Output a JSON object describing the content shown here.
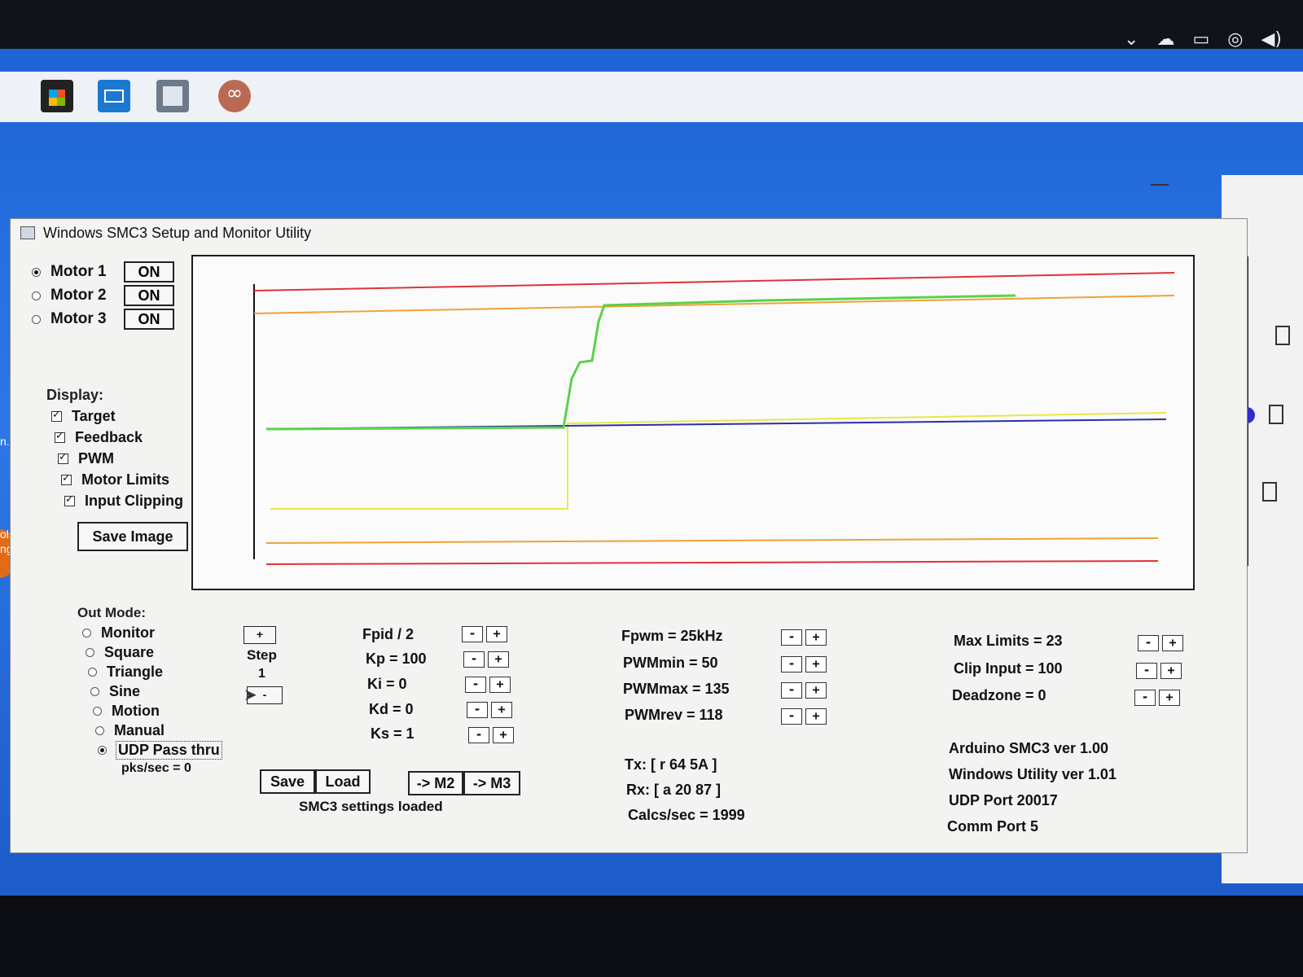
{
  "window": {
    "title": "Windows SMC3 Setup and Monitor Utility"
  },
  "desktop": {
    "side_label_1": "ols",
    "side_label_2": "ngine",
    "side_label_3": "n..."
  },
  "motors": [
    {
      "label": "Motor 1",
      "button": "ON",
      "selected": true
    },
    {
      "label": "Motor 2",
      "button": "ON",
      "selected": false
    },
    {
      "label": "Motor 3",
      "button": "ON",
      "selected": false
    }
  ],
  "display": {
    "heading": "Display:",
    "options": [
      {
        "label": "Target",
        "checked": true
      },
      {
        "label": "Feedback",
        "checked": true
      },
      {
        "label": "PWM",
        "checked": true
      },
      {
        "label": "Motor Limits",
        "checked": true
      },
      {
        "label": "Input Clipping",
        "checked": true
      }
    ],
    "save_image": "Save Image"
  },
  "out_mode": {
    "heading": "Out Mode:",
    "options": [
      {
        "label": "Monitor",
        "selected": false
      },
      {
        "label": "Square",
        "selected": false
      },
      {
        "label": "Triangle",
        "selected": false
      },
      {
        "label": "Sine",
        "selected": false
      },
      {
        "label": "Motion",
        "selected": false
      },
      {
        "label": "Manual",
        "selected": false
      },
      {
        "label": "UDP Pass thru",
        "selected": true
      }
    ],
    "pks_sec": "pks/sec = 0"
  },
  "step": {
    "plus": "+",
    "label": "Step",
    "value": "1",
    "minus": "-"
  },
  "pid_params": {
    "fpid": "Fpid / 2",
    "kp": "Kp = 100",
    "ki": "Ki = 0",
    "kd": "Kd = 0",
    "ks": "Ks = 1"
  },
  "pwm_params": {
    "fpwm": "Fpwm = 25kHz",
    "pwmmin": "PWMmin = 50",
    "pwmmax": "PWMmax = 135",
    "pwmrev": "PWMrev = 118"
  },
  "limit_params": {
    "max_limits": "Max Limits = 23",
    "clip_input": "Clip Input = 100",
    "deadzone": "Deadzone = 0"
  },
  "buttons": {
    "save": "Save",
    "load": "Load",
    "to_m2": "-> M2",
    "to_m3": "-> M3",
    "minus": "-",
    "plus": "+"
  },
  "status": {
    "settings": "SMC3 settings loaded"
  },
  "comm": {
    "tx": "Tx: [ r 64 5A ]",
    "rx": "Rx: [ a 20 87 ]",
    "calcs": "Calcs/sec = 1999"
  },
  "versions": {
    "arduino": "Arduino SMC3 ver 1.00",
    "windows": "Windows Utility ver 1.01",
    "udp_port": "UDP Port 20017",
    "comm_port": "Comm Port 5"
  },
  "colors": {
    "motor_limit": "#e0323a",
    "input_clip": "#f0a23a",
    "feedback": "#5ad24a",
    "target": "#2a2fa8",
    "pwm": "#e6e84a"
  },
  "icons": {
    "tray": [
      "chevron-up-icon",
      "onedrive-sync-icon",
      "battery-icon",
      "globe-network-icon",
      "volume-icon"
    ],
    "taskbar": [
      "store-icon",
      "mail-icon",
      "app-window-icon",
      "arduino-icon"
    ]
  }
}
